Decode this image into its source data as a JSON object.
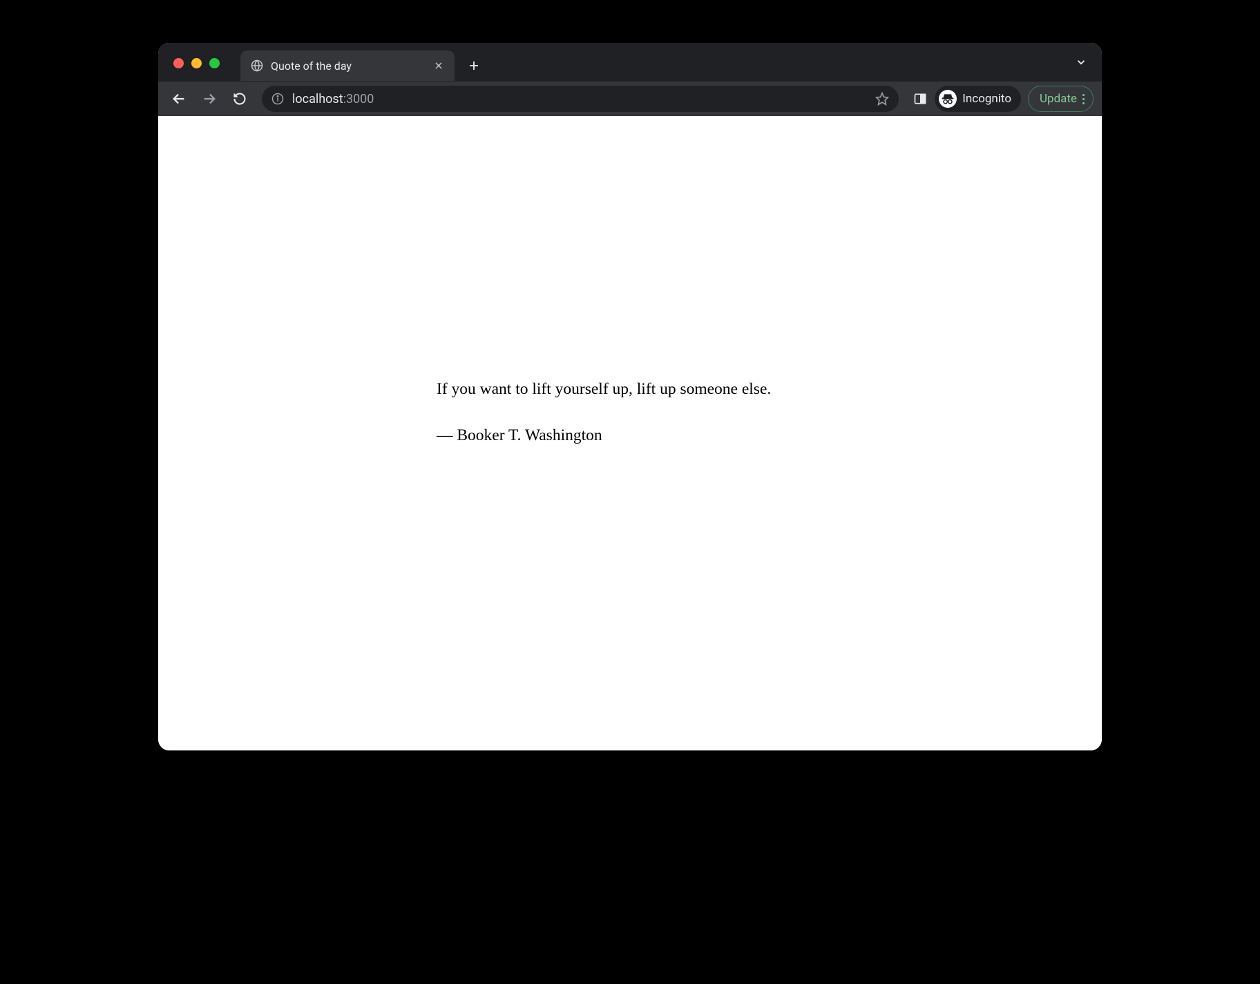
{
  "browser": {
    "tab": {
      "title": "Quote of the day"
    },
    "url": {
      "host": "localhost",
      "port": ":3000"
    },
    "incognito_label": "Incognito",
    "update_label": "Update"
  },
  "page": {
    "quote_text": "If you want to lift yourself up, lift up someone else.",
    "quote_author": "— Booker T. Washington"
  }
}
